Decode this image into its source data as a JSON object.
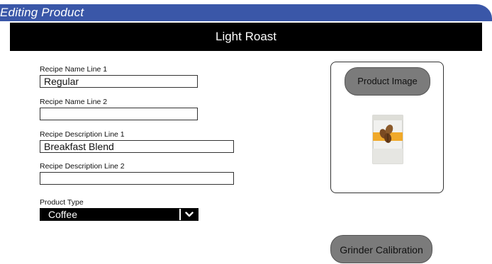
{
  "window": {
    "title": "Editing Product"
  },
  "header": {
    "product_name": "Light Roast"
  },
  "form": {
    "recipe_name_1": {
      "label": "Recipe Name Line 1",
      "value": "Regular"
    },
    "recipe_name_2": {
      "label": "Recipe Name Line 2",
      "value": ""
    },
    "recipe_desc_1": {
      "label": "Recipe Description Line 1",
      "value": "Breakfast Blend"
    },
    "recipe_desc_2": {
      "label": "Recipe Description Line 2",
      "value": ""
    },
    "product_type": {
      "label": "Product Type",
      "value": "Coffee"
    }
  },
  "image_panel": {
    "button_label": "Product Image",
    "icon": "coffee-bag-icon"
  },
  "grinder": {
    "button_label": "Grinder Calibration"
  },
  "colors": {
    "title_bar": "#3a57a8",
    "header_bar": "#000000",
    "button": "#7b7b7b",
    "bag_band": "#f0a92a"
  }
}
